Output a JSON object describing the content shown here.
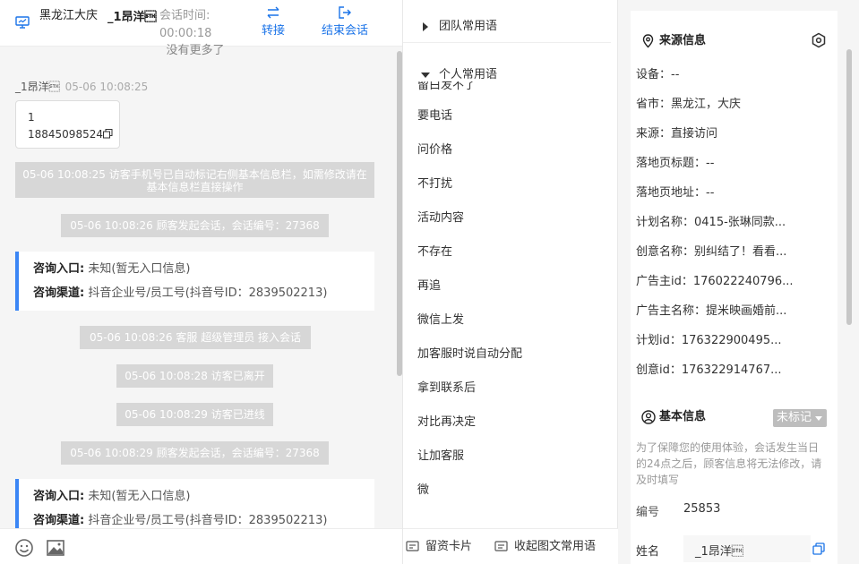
{
  "header": {
    "location": "黑龙江大庆",
    "visitor_name": "_1昂洋\u0002",
    "session_time_label": "会话时间:",
    "session_time": "00:00:18",
    "transfer_label": "转接",
    "end_label": "结束会话"
  },
  "chat": {
    "no_more": "没有更多了",
    "visitor_name": "_1昂洋\u0002",
    "visitor_time": "05-06 10:08:25",
    "phone_line1": "1",
    "phone_line2": "18845098524",
    "sys1": "05-06 10:08:25 访客手机号已自动标记右侧基本信息栏，如需修改请在基本信息栏直接操作",
    "sys2": "05-06 10:08:26 顾客发起会话，会话编号：27368",
    "sys3": "05-06 10:08:26 客服 超级管理员 接入会话",
    "sys4": "05-06 10:08:28 访客已离开",
    "sys5": "05-06 10:08:29 访客已进线",
    "sys6": "05-06 10:08:29 顾客发起会话，会话编号：27368",
    "entry_label": "咨询入口:",
    "entry_value": "未知(暂无入口信息)",
    "channel_label": "咨询渠道:",
    "channel_value": "抖音企业号/员工号(抖音号ID：2839502213)"
  },
  "phrases": {
    "team_group": "团队常用语",
    "personal_group": "个人常用语",
    "cut_item": "留白发不了",
    "items": [
      "要电话",
      "问价格",
      "不打扰",
      "活动内容",
      "不存在",
      "再追",
      "微信上发",
      "加客服时说自动分配",
      "拿到联系后",
      "对比再决定",
      "让加客服",
      "微"
    ],
    "leave_card": "留资卡片",
    "collapse_rich": "收起图文常用语"
  },
  "source": {
    "title": "来源信息",
    "rows": [
      "设备：--",
      "省市：黑龙江，大庆",
      "来源：直接访问",
      "落地页标题：--",
      "落地页地址：--",
      "计划名称：0415-张琳同款...",
      "创意名称：别纠结了！看看...",
      "广告主id：176022240796...",
      "广告主名称：提米映画婚前...",
      "计划id：176322900495...",
      "创意id：176322914767..."
    ]
  },
  "basic": {
    "title": "基本信息",
    "mark": "未标记",
    "note": "为了保障您的使用体验，会话发生当日的24点之后，顾客信息将无法修改，请及时填写",
    "id_label": "编号",
    "id_value": "25853",
    "name_label": "姓名",
    "name_value": "_1昂洋\u0002"
  },
  "colors": {
    "accent": "#1a73e8",
    "card_border": "#3b86f5",
    "sys_bg": "#d7d7d7",
    "mark_bg": "#bdbdbd"
  }
}
